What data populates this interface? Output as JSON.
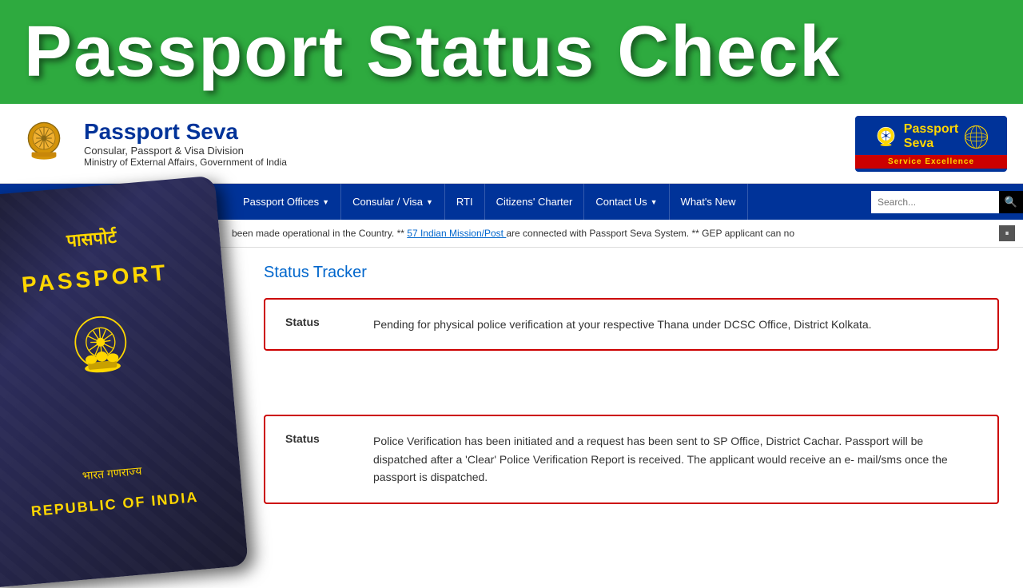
{
  "banner": {
    "title": "Passport Status Check"
  },
  "header": {
    "site_name": "Passport Seva",
    "subtitle1": "Consular, Passport & Visa Division",
    "subtitle2": "Ministry of External Affairs, Government of India",
    "logo_text1": "Passport",
    "logo_text2": "Seva",
    "logo_tagline": "Service Excellence"
  },
  "nav": {
    "items": [
      {
        "label": "Passport Offices",
        "has_dropdown": true
      },
      {
        "label": "Consular / Visa",
        "has_dropdown": true
      },
      {
        "label": "RTI",
        "has_dropdown": false
      },
      {
        "label": "Citizens' Charter",
        "has_dropdown": false
      },
      {
        "label": "Contact Us",
        "has_dropdown": true
      },
      {
        "label": "What's New",
        "has_dropdown": false
      }
    ],
    "search_placeholder": "Search..."
  },
  "ticker": {
    "text": "been made operational in the Country. **",
    "link_text": "57 Indian Mission/Post",
    "link_suffix": " are connected with Passport Seva System. ** GEP applicant can no"
  },
  "main": {
    "section_title": "Status Tracker",
    "status_cards": [
      {
        "label": "Status",
        "value": "Pending for physical police verification at your respective Thana under DCSC Office, District Kolkata."
      },
      {
        "label": "Status",
        "value": "Police Verification has been initiated and a request has been sent to SP Office, District Cachar. Passport will be dispatched after a 'Clear' Police Verification Report is received. The applicant would receive an e- mail/sms once the passport is dispatched."
      }
    ]
  },
  "passport": {
    "hindi_title": "पासपोर्ट",
    "english_title": "PASSPORT",
    "bottom_hindi": "भारत गणराज्य",
    "bottom_english": "REPUBLIC OF INDIA"
  }
}
